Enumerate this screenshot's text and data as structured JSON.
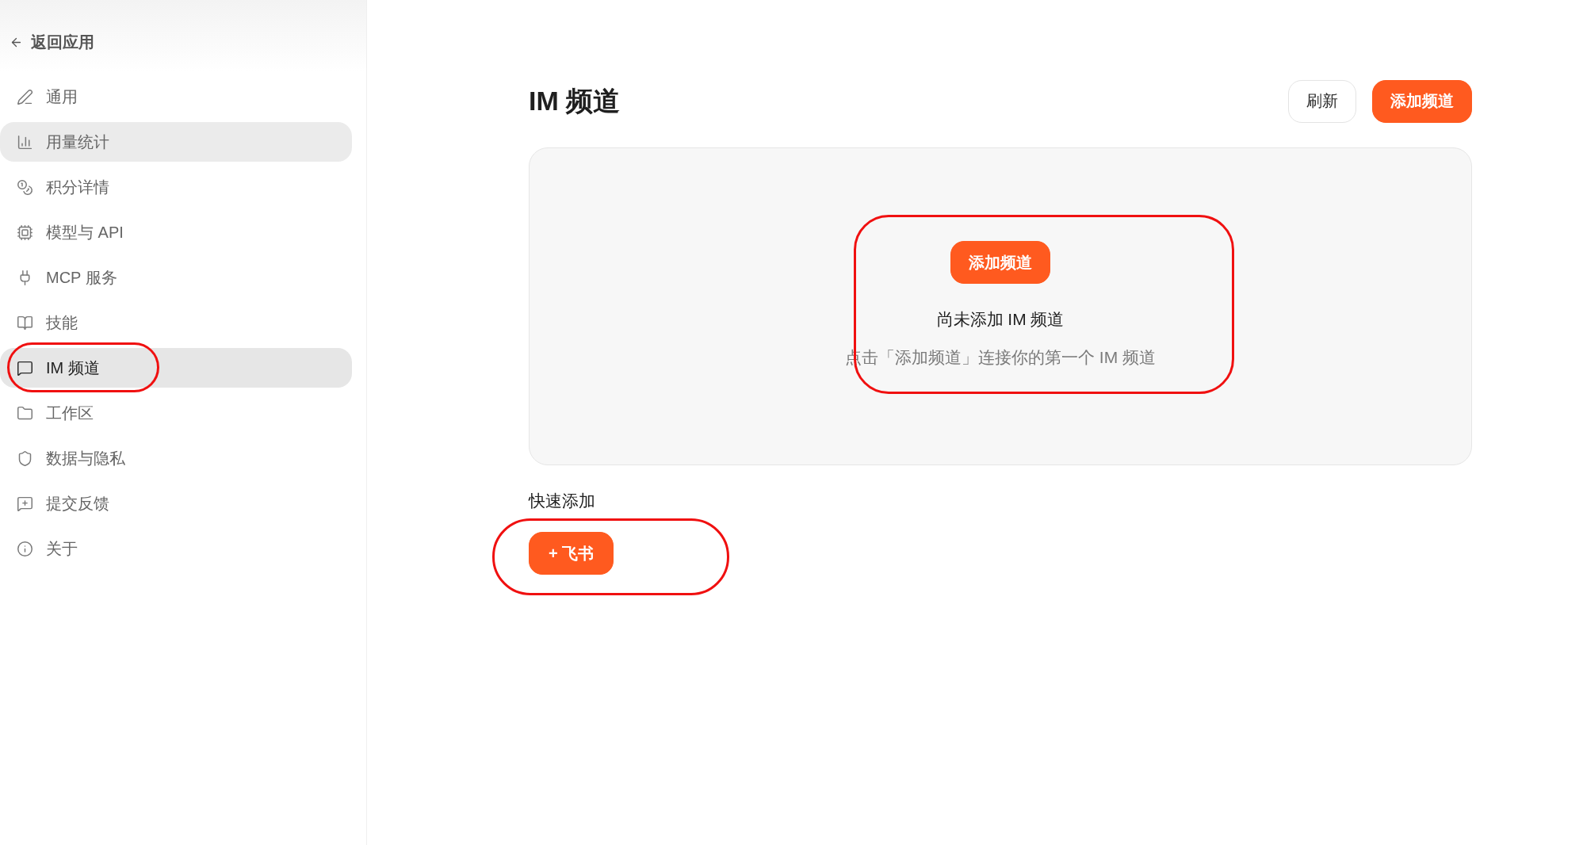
{
  "sidebar": {
    "back_link": "返回应用",
    "items": [
      {
        "label": "通用",
        "selected": false,
        "hovered": false,
        "highlighted": false
      },
      {
        "label": "用量统计",
        "selected": false,
        "hovered": true,
        "highlighted": false
      },
      {
        "label": "积分详情",
        "selected": false,
        "hovered": false,
        "highlighted": false
      },
      {
        "label": "模型与 API",
        "selected": false,
        "hovered": false,
        "highlighted": false
      },
      {
        "label": "MCP 服务",
        "selected": false,
        "hovered": false,
        "highlighted": false
      },
      {
        "label": "技能",
        "selected": false,
        "hovered": false,
        "highlighted": false
      },
      {
        "label": "IM 频道",
        "selected": true,
        "hovered": false,
        "highlighted": true
      },
      {
        "label": "工作区",
        "selected": false,
        "hovered": false,
        "highlighted": false
      },
      {
        "label": "数据与隐私",
        "selected": false,
        "hovered": false,
        "highlighted": false
      },
      {
        "label": "提交反馈",
        "selected": false,
        "hovered": false,
        "highlighted": false
      },
      {
        "label": "关于",
        "selected": false,
        "hovered": false,
        "highlighted": false
      }
    ]
  },
  "header": {
    "title": "IM 频道",
    "buttons": [
      {
        "label": "刷新",
        "kind": "secondary"
      },
      {
        "label": "添加频道",
        "kind": "primary"
      }
    ]
  },
  "empty_state": {
    "highlighted": true,
    "button": "添加频道",
    "title": "尚未添加 IM 频道",
    "description": "点击「添加频道」连接你的第一个 IM 频道"
  },
  "quick_add": {
    "title": "快速添加",
    "highlighted": true,
    "buttons": [
      "+ 飞书"
    ]
  }
}
